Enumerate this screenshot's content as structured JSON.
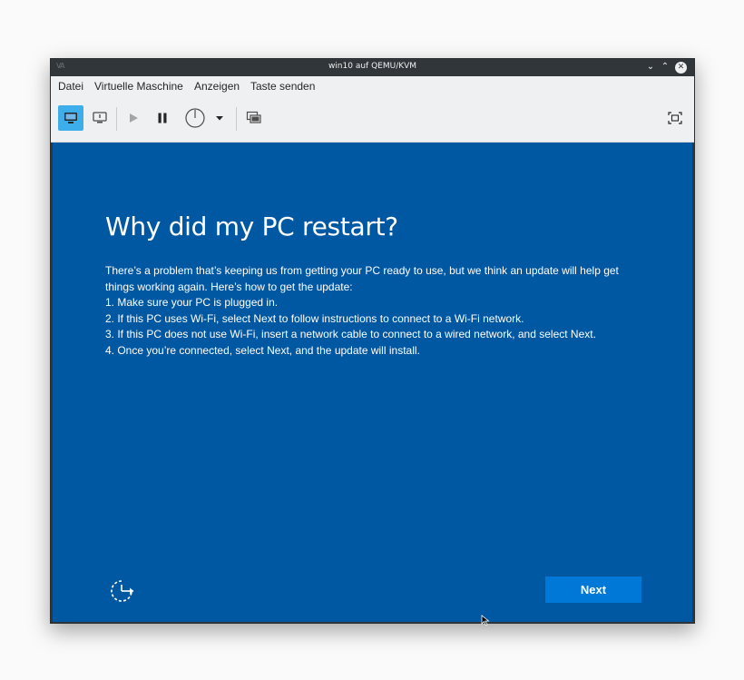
{
  "window": {
    "title": "win10 auf QEMU/KVM",
    "app_icon_text": "VA",
    "controls": {
      "minimize": "⌄",
      "maximize": "⌃",
      "close": "✕"
    }
  },
  "menubar": {
    "items": [
      {
        "label": "Datei"
      },
      {
        "label": "Virtuelle Maschine"
      },
      {
        "label": "Anzeigen"
      },
      {
        "label": "Taste senden"
      }
    ]
  },
  "toolbar": {
    "buttons": [
      {
        "name": "console-icon",
        "active": true
      },
      {
        "name": "details-icon"
      },
      {
        "name": "run-icon"
      },
      {
        "name": "pause-icon"
      },
      {
        "name": "power-icon"
      },
      {
        "name": "chevron-down-icon"
      },
      {
        "name": "snapshots-icon"
      },
      {
        "name": "fullscreen-icon"
      }
    ]
  },
  "guest": {
    "heading": "Why did my PC restart?",
    "paragraphs": [
      "There’s a problem that’s keeping us from getting your PC ready to use, but we think an update will help get things working again. Here’s how to get the update:",
      "1. Make sure your PC is plugged in.",
      "2. If this PC uses Wi-Fi, select Next to follow instructions to connect to a Wi-Fi network.",
      "3. If this PC does not use Wi-Fi, insert a network cable to connect to a wired network, and select Next.",
      "4. Once you’re connected, select Next, and the update will install."
    ],
    "next_label": "Next",
    "accessibility_icon": "ease-of-access-icon"
  },
  "colors": {
    "guest_background": "#0058a3",
    "next_button": "#0078d7",
    "active_toolbar": "#3daee9",
    "titlebar": "#31363b"
  }
}
